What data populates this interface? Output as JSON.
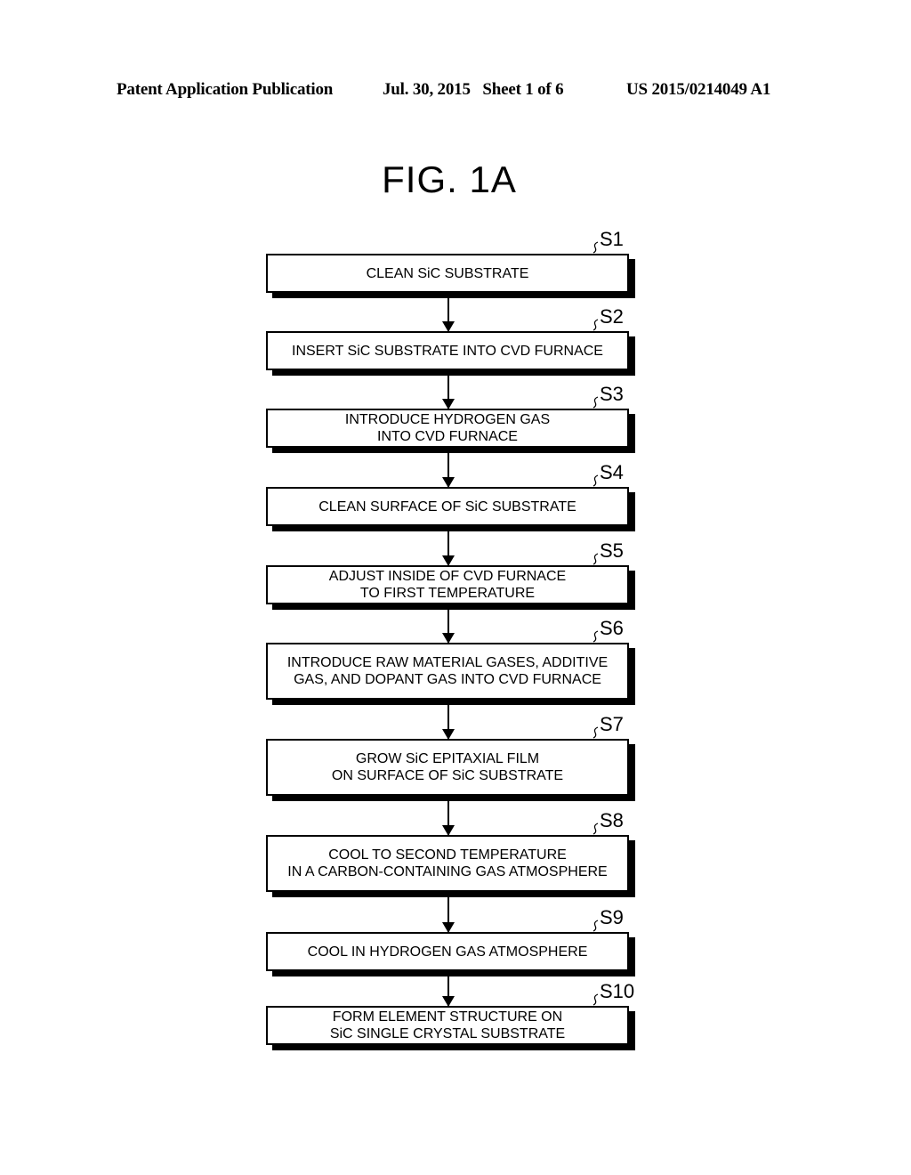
{
  "header": {
    "left": "Patent Application Publication",
    "middle": "Jul. 30, 2015   Sheet 1 of 6",
    "right": "US 2015/0214049 A1"
  },
  "figure_title": "FIG. 1A",
  "steps": [
    {
      "label": "S1",
      "text": "CLEAN SiC SUBSTRATE"
    },
    {
      "label": "S2",
      "text": "INSERT SiC SUBSTRATE INTO CVD FURNACE"
    },
    {
      "label": "S3",
      "text": "INTRODUCE HYDROGEN GAS\nINTO CVD FURNACE"
    },
    {
      "label": "S4",
      "text": "CLEAN SURFACE OF SiC SUBSTRATE"
    },
    {
      "label": "S5",
      "text": "ADJUST INSIDE OF CVD FURNACE\nTO FIRST TEMPERATURE"
    },
    {
      "label": "S6",
      "text": "INTRODUCE RAW MATERIAL GASES, ADDITIVE\nGAS, AND DOPANT GAS INTO CVD FURNACE"
    },
    {
      "label": "S7",
      "text": "GROW SiC EPITAXIAL FILM\nON SURFACE OF SiC SUBSTRATE"
    },
    {
      "label": "S8",
      "text": "COOL TO SECOND TEMPERATURE\nIN A CARBON-CONTAINING GAS ATMOSPHERE"
    },
    {
      "label": "S9",
      "text": "COOL IN HYDROGEN GAS ATMOSPHERE"
    },
    {
      "label": "S10",
      "text": "FORM ELEMENT STRUCTURE ON\nSiC SINGLE CRYSTAL SUBSTRATE"
    }
  ]
}
